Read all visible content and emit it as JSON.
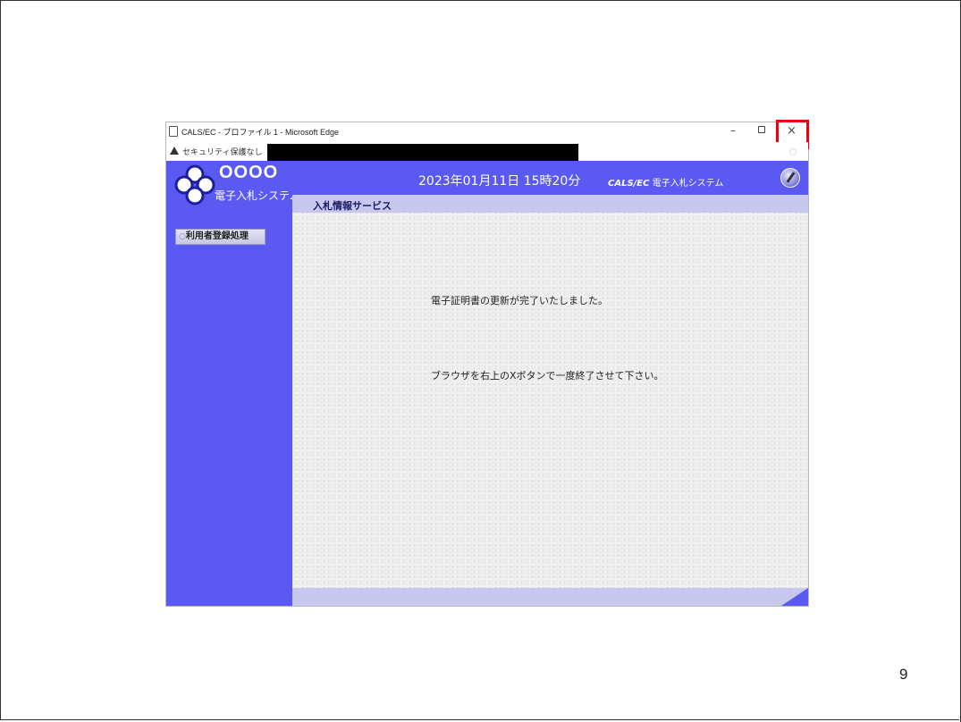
{
  "browser": {
    "window_title": "CALS/EC - プロファイル 1 - Microsoft Edge",
    "minimize_label": "–",
    "close_label": "×",
    "security_label": "セキュリティ保護なし"
  },
  "app": {
    "org_name": "OOOO",
    "system_name": "電子入札システム",
    "datetime": "2023年01月11日 15時20分",
    "cals_prefix": "CALS/EC",
    "cals_suffix": "電子入札システム",
    "service_tab": "入札情報サービス",
    "menu": [
      {
        "label": "利用者登録処理"
      }
    ],
    "messages": {
      "renewal_complete": "電子証明書の更新が完了いたしました。",
      "close_instruction": "ブラウザを右上のXボタンで一度終了させて下さい。"
    },
    "colors": {
      "primary": "#5a5af2",
      "light_bar": "#c8c8ef",
      "highlight": "#e60012"
    }
  },
  "slide": {
    "page_number": "9"
  },
  "icons": [
    "page-icon",
    "warning-icon",
    "logo-icon",
    "help-icon"
  ]
}
